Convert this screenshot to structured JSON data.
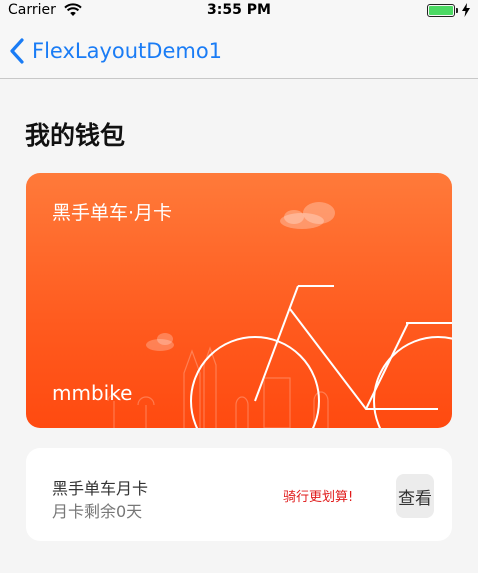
{
  "status": {
    "carrier": "Carrier",
    "time": "3:55 PM"
  },
  "nav": {
    "back_label": "FlexLayoutDemo1"
  },
  "page": {
    "title": "我的钱包"
  },
  "card": {
    "title": "黑手单车·月卡",
    "brand": "mmbike"
  },
  "info": {
    "name": "黑手单车月卡",
    "subtitle": "月卡剩余0天",
    "promo": "骑行更划算!",
    "view_label": "查看"
  },
  "colors": {
    "accent": "#1a7cf5",
    "card_gradient_top": "#ff7a3a",
    "card_gradient_bottom": "#ff4a10",
    "promo": "#e01b1b",
    "battery": "#4cd964"
  },
  "icons": [
    "wifi-icon",
    "battery-icon",
    "charging-bolt-icon",
    "back-chevron-icon",
    "cloud-icon",
    "bicycle-illustration"
  ]
}
